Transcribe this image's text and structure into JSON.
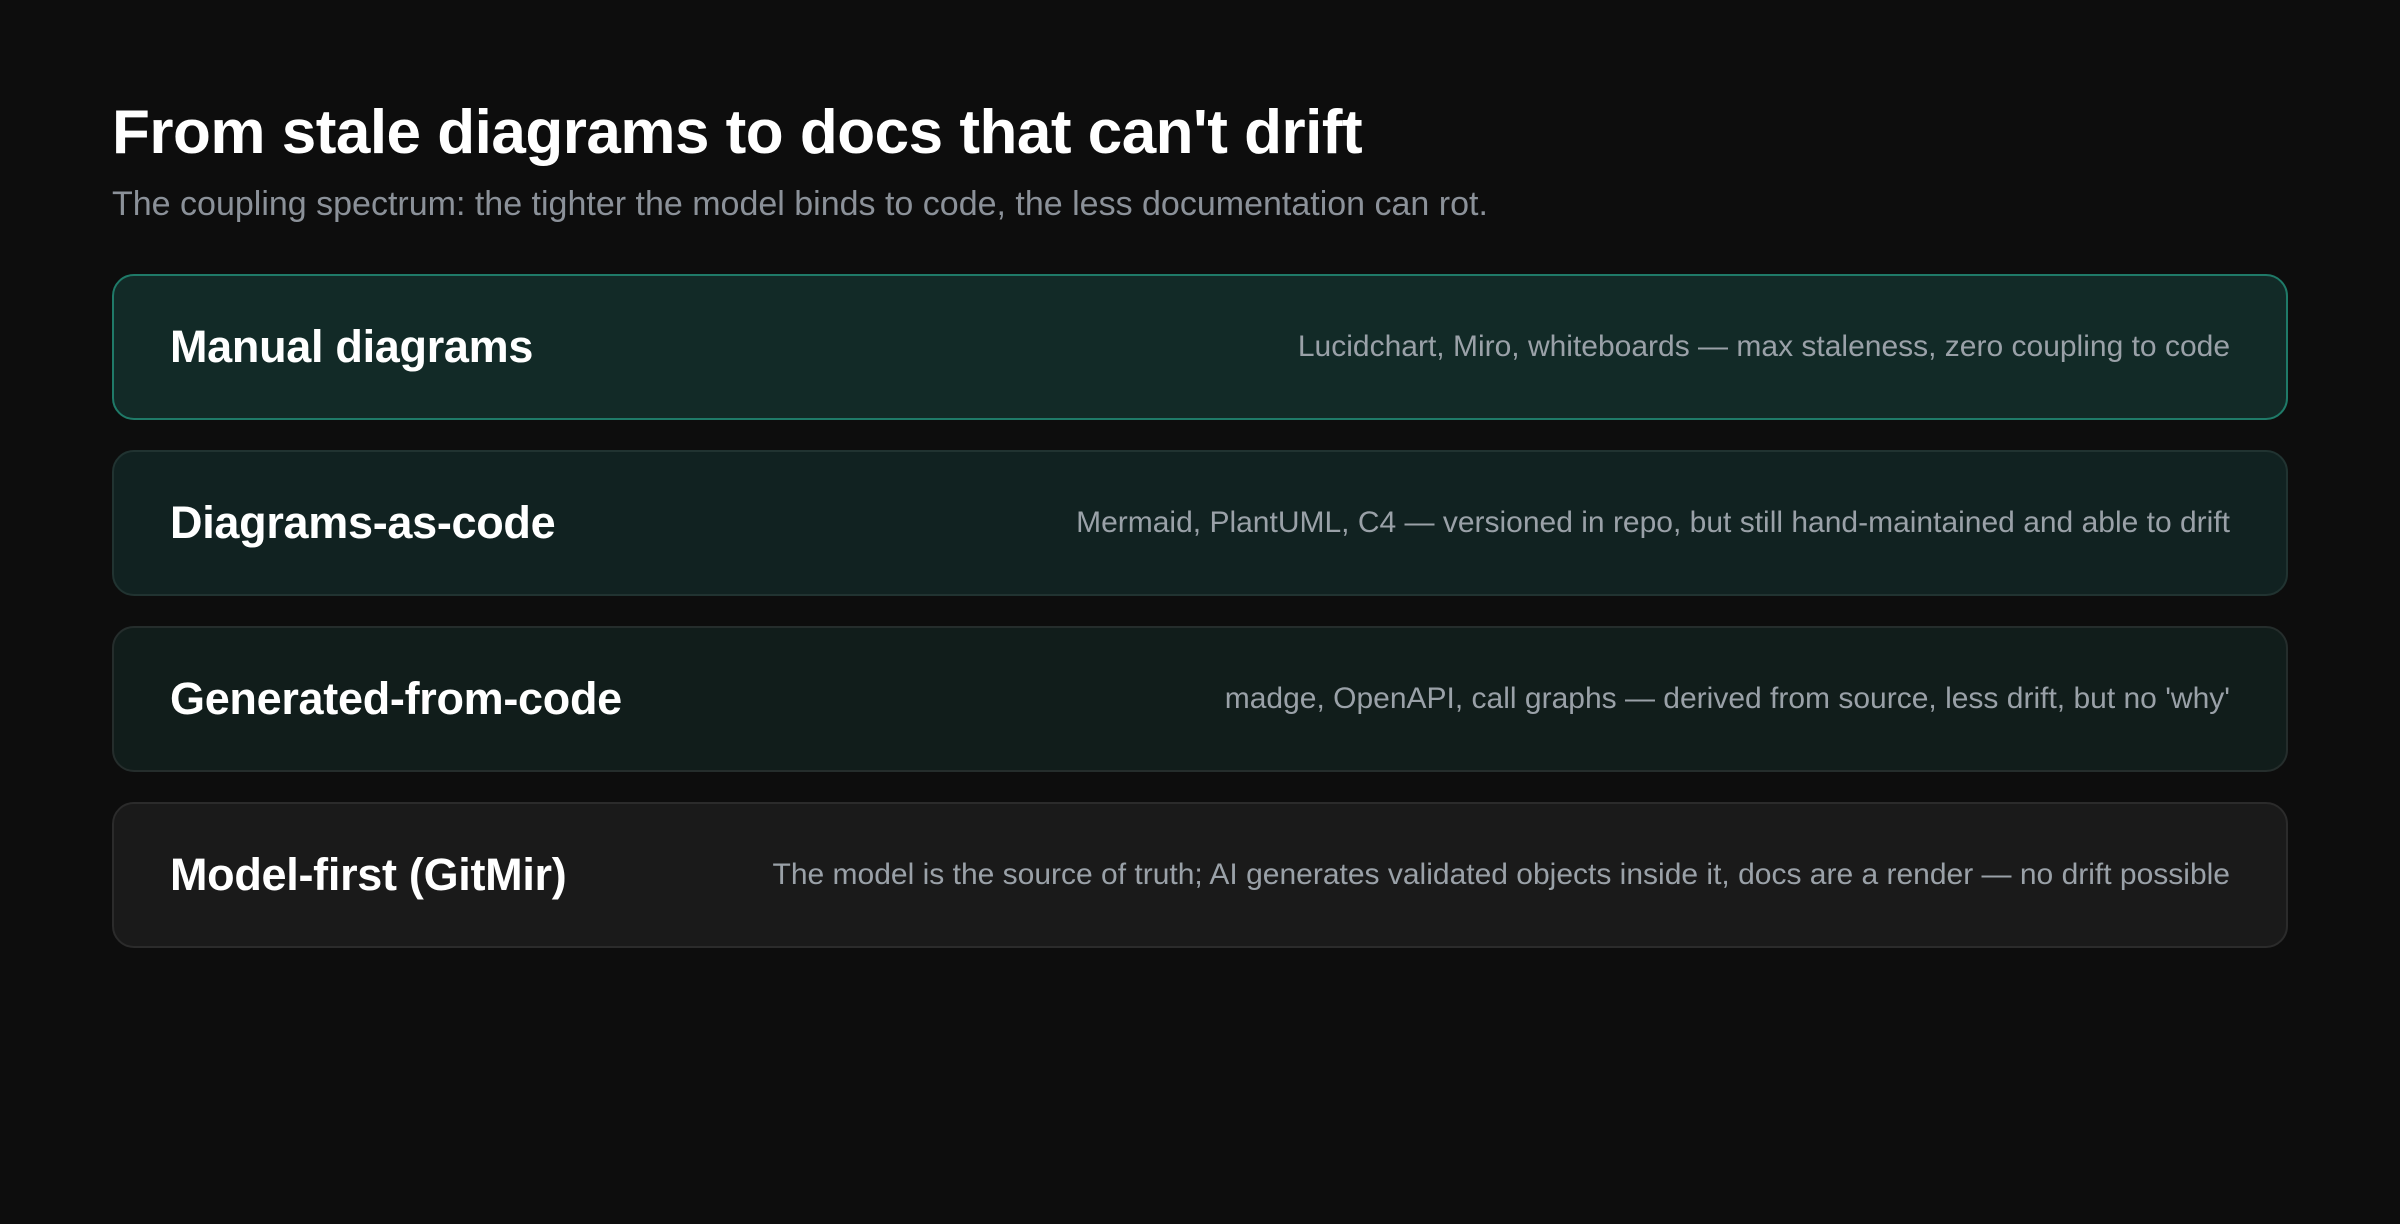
{
  "header": {
    "title": "From stale diagrams to docs that can't drift",
    "subtitle": "The coupling spectrum: the tighter the model binds to code, the less documentation can rot."
  },
  "colors": {
    "background": "#0d0d0d",
    "highlight_border": "#1f7a68",
    "highlight_fill": "#122a27"
  },
  "tiers": [
    {
      "name": "Manual diagrams",
      "description": "Lucidchart, Miro, whiteboards — max staleness, zero coupling to code"
    },
    {
      "name": "Diagrams-as-code",
      "description": "Mermaid, PlantUML, C4 — versioned in repo, but still hand-maintained and able to drift"
    },
    {
      "name": "Generated-from-code",
      "description": "madge, OpenAPI, call graphs — derived from source, less drift, but no 'why'"
    },
    {
      "name": "Model-first (GitMir)",
      "description": "The model is the source of truth; AI generates validated objects inside it, docs are a render — no drift possible"
    }
  ]
}
